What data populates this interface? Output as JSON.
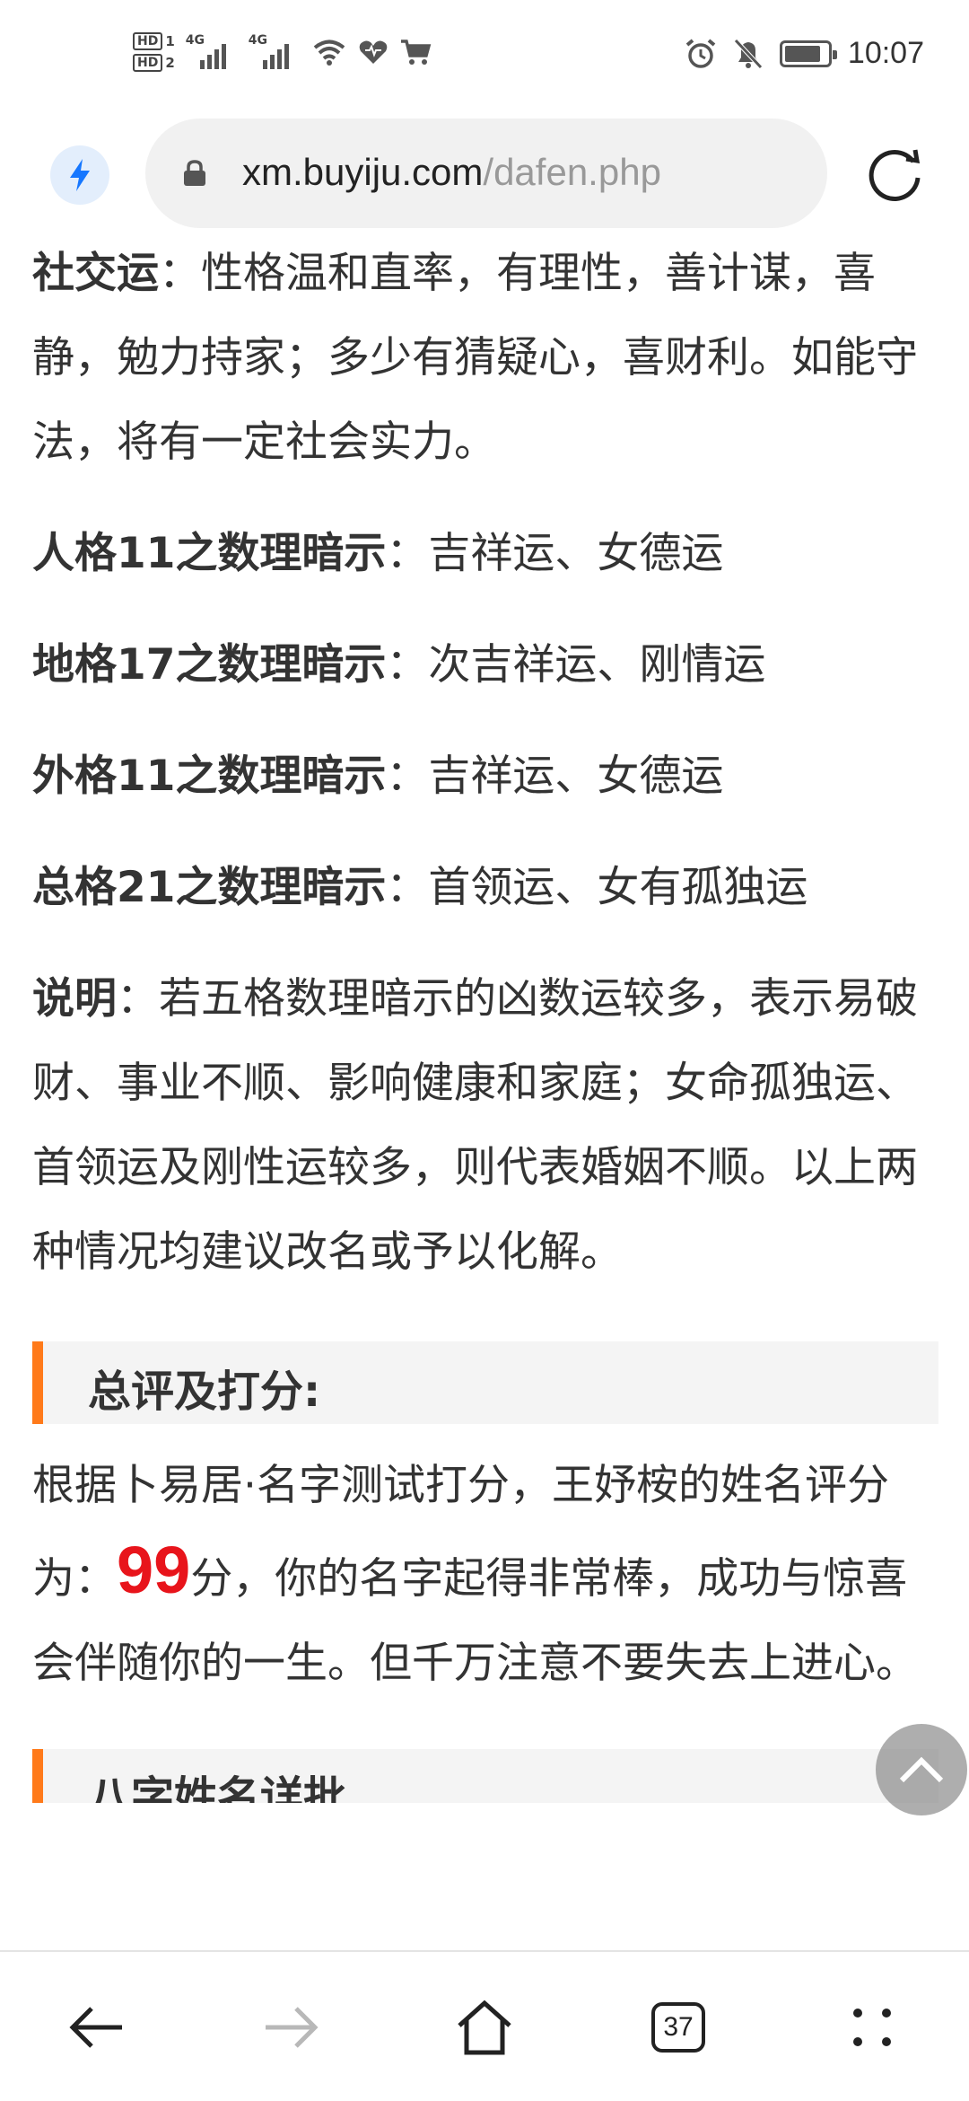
{
  "status_bar": {
    "hd1": "HD",
    "hd1_num": "1",
    "hd2": "HD",
    "hd2_num": "2",
    "signal1_label": "4G",
    "signal2_label": "4G",
    "battery_level_percent": 85,
    "time": "10:07"
  },
  "browser": {
    "url_host": "xm.buyiju.com",
    "url_path": "/dafen.php",
    "open_tab_count": "37"
  },
  "content": {
    "social": {
      "label": "社交运",
      "text": "：性格温和直率，有理性，善计谋，喜静，勉力持家；多少有猜疑心，喜财利。如能守法，将有一定社会实力。"
    },
    "hints": [
      {
        "label": "人格11之数理暗示",
        "text": "：吉祥运、女德运"
      },
      {
        "label": "地格17之数理暗示",
        "text": "：次吉祥运、刚情运"
      },
      {
        "label": "外格11之数理暗示",
        "text": "：吉祥运、女德运"
      },
      {
        "label": "总格21之数理暗示",
        "text": "：首领运、女有孤独运"
      }
    ],
    "note": {
      "label": "说明",
      "text": "：若五格数理暗示的凶数运较多，表示易破财、事业不顺、影响健康和家庭；女命孤独运、首领运及刚性运较多，则代表婚姻不顺。以上两种情况均建议改名或予以化解。"
    },
    "summary": {
      "heading": "总评及打分:",
      "text_before": "根据卜易居·名字测试打分，王妤桉的姓名评分为：",
      "score": "99",
      "text_after": "分，你的名字起得非常棒，成功与惊喜会伴随你的一生。但千万注意不要失去上进心。"
    },
    "next_heading": "八字姓名详批"
  },
  "colors": {
    "accent_orange": "#ff7a1a",
    "score_red": "#e8141b",
    "bolt_blue": "#1677ff"
  }
}
